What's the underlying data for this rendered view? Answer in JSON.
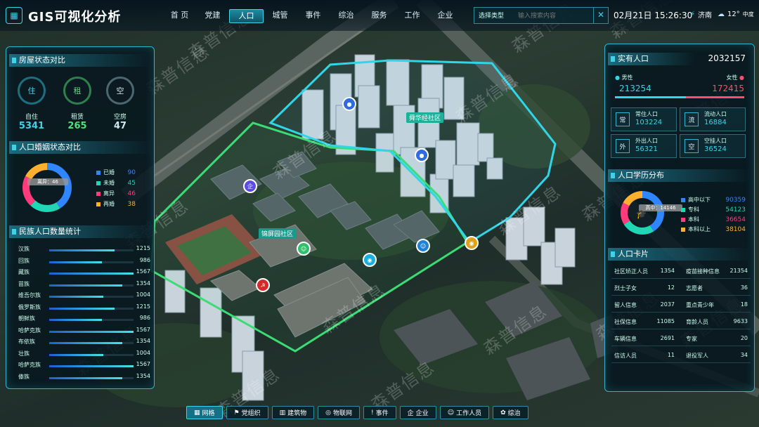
{
  "app": {
    "title": "GIS可视化分析",
    "logo_icon": "grid-icon"
  },
  "nav": {
    "items": [
      "首 页",
      "党建",
      "人口",
      "城管",
      "事件",
      "综治",
      "服务",
      "工作",
      "企业"
    ],
    "active_index": 2
  },
  "search": {
    "type_label": "选择类型",
    "placeholder": "输入搜索内容",
    "close_icon": "close-icon"
  },
  "status": {
    "datetime": "02月21日 15:26:30",
    "city": "济南",
    "temp": "12°",
    "weather": "中度"
  },
  "colors": {
    "accent": "#3fd2e8",
    "male": "#2fd6e8",
    "female": "#ff4d6a",
    "green": "#4fe07a"
  },
  "house_status": {
    "title": "房屋状态对比",
    "items": [
      {
        "icon_text": "住",
        "label": "自住",
        "value": "5341",
        "color": "#3fd2e8"
      },
      {
        "icon_text": "租",
        "label": "租赁",
        "value": "265",
        "color": "#4fe07a"
      },
      {
        "icon_text": "空",
        "label": "空房",
        "value": "47",
        "color": "#cfe8ee"
      }
    ]
  },
  "marriage": {
    "title": "人口婚姻状态对比",
    "center_label": "离异：46",
    "items": [
      {
        "label": "已婚",
        "value": "90",
        "color": "#2f86ff"
      },
      {
        "label": "未婚",
        "value": "45",
        "color": "#21d6b4"
      },
      {
        "label": "离异",
        "value": "46",
        "color": "#ff3b7b"
      },
      {
        "label": "再婚",
        "value": "38",
        "color": "#ffb02e"
      }
    ]
  },
  "ethnic": {
    "title": "民族人口数量统计",
    "max": 1567,
    "rows": [
      {
        "name": "汉族",
        "value": "1215"
      },
      {
        "name": "回族",
        "value": "986"
      },
      {
        "name": "藏族",
        "value": "1567"
      },
      {
        "name": "苗族",
        "value": "1354"
      },
      {
        "name": "维吾尔族",
        "value": "1004"
      },
      {
        "name": "俄罗斯族",
        "value": "1215"
      },
      {
        "name": "朝鲜族",
        "value": "986"
      },
      {
        "name": "哈萨克族",
        "value": "1567"
      },
      {
        "name": "布依族",
        "value": "1354"
      },
      {
        "name": "壮族",
        "value": "1004"
      },
      {
        "name": "哈萨克族",
        "value": "1567"
      },
      {
        "name": "傣族",
        "value": "1354"
      }
    ]
  },
  "population": {
    "title": "实有人口",
    "total": "2032157",
    "male_label": "男性",
    "male": "213254",
    "female_label": "女性",
    "female": "172415",
    "male_share": 0.55,
    "cards": [
      {
        "icon": "常",
        "label": "常住人口",
        "value": "103224"
      },
      {
        "icon": "流",
        "label": "流动人口",
        "value": "16884"
      },
      {
        "icon": "外",
        "label": "外出人口",
        "value": "56321"
      },
      {
        "icon": "空",
        "label": "空挂人口",
        "value": "36524"
      }
    ]
  },
  "education": {
    "title": "人口学历分布",
    "center_label": "高中：14146",
    "items": [
      {
        "label": "高中以下",
        "value": "90359",
        "color": "#2f86ff"
      },
      {
        "label": "专科",
        "value": "54123",
        "color": "#21d6b4"
      },
      {
        "label": "本科",
        "value": "36654",
        "color": "#ff3b7b"
      },
      {
        "label": "本科以上",
        "value": "38104",
        "color": "#ffb02e"
      }
    ]
  },
  "person_cards": {
    "title": "人口卡片",
    "rows": [
      [
        "社区矫正人员",
        "1354",
        "疫苗接种信息",
        "21354"
      ],
      [
        "烈士子女",
        "12",
        "志愿者",
        "36"
      ],
      [
        "留人信息",
        "2037",
        "重点青少年",
        "18"
      ],
      [
        "社保信息",
        "11085",
        "育龄人员",
        "9633"
      ],
      [
        "车辆信息",
        "2691",
        "专家",
        "20"
      ],
      [
        "信访人员",
        "11",
        "退役军人",
        "34"
      ]
    ]
  },
  "map": {
    "community_a": "舜华经社区",
    "community_b": "锦屏园社区",
    "watermark": "森普信息"
  },
  "bottom_bar": [
    {
      "icon": "grid-icon",
      "glyph": "▦",
      "label": "网格"
    },
    {
      "icon": "flag-icon",
      "glyph": "⚑",
      "label": "党组织"
    },
    {
      "icon": "building-icon",
      "glyph": "▥",
      "label": "建筑物"
    },
    {
      "icon": "iot-icon",
      "glyph": "◎",
      "label": "物联网"
    },
    {
      "icon": "alert-icon",
      "glyph": "!",
      "label": "事件"
    },
    {
      "icon": "enterprise-icon",
      "glyph": "企",
      "label": "企业"
    },
    {
      "icon": "worker-icon",
      "glyph": "☺",
      "label": "工作人员"
    },
    {
      "icon": "governance-icon",
      "glyph": "✿",
      "label": "综治"
    }
  ]
}
